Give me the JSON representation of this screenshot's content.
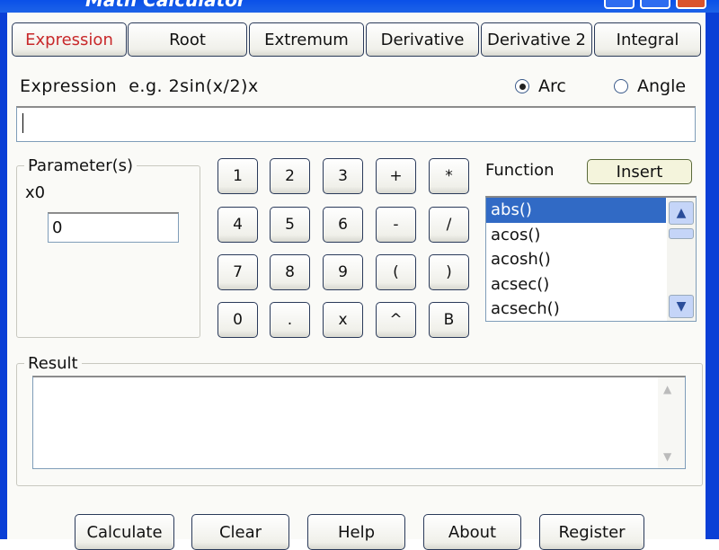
{
  "window": {
    "title": "Math Calculator"
  },
  "tabs": [
    {
      "label": "Expression",
      "active": true
    },
    {
      "label": "Root"
    },
    {
      "label": "Extremum"
    },
    {
      "label": "Derivative"
    },
    {
      "label": "Derivative 2"
    },
    {
      "label": "Integral"
    }
  ],
  "expression": {
    "label": "Expression  e.g. 2sin(x/2)x",
    "value": "",
    "mode_options": [
      {
        "label": "Arc",
        "selected": true
      },
      {
        "label": "Angle",
        "selected": false
      }
    ]
  },
  "parameters": {
    "legend": "Parameter(s)",
    "name": "x0",
    "value": "0"
  },
  "keypad": [
    [
      "1",
      "2",
      "3",
      "+",
      "*"
    ],
    [
      "4",
      "5",
      "6",
      "-",
      "/"
    ],
    [
      "7",
      "8",
      "9",
      "(",
      ")"
    ],
    [
      "0",
      ".",
      "x",
      "^",
      "B"
    ]
  ],
  "function": {
    "label": "Function",
    "insert_label": "Insert",
    "items": [
      "abs()",
      "acos()",
      "acosh()",
      "acsec()",
      "acsech()"
    ],
    "selected": "abs()"
  },
  "result": {
    "legend": "Result",
    "value": ""
  },
  "buttons": {
    "calculate": "Calculate",
    "clear": "Clear",
    "help": "Help",
    "about": "About",
    "register": "Register"
  },
  "colors": {
    "active_tab": "#c8282a",
    "selection": "#316ac5",
    "titlebar": "#0a50e8"
  }
}
